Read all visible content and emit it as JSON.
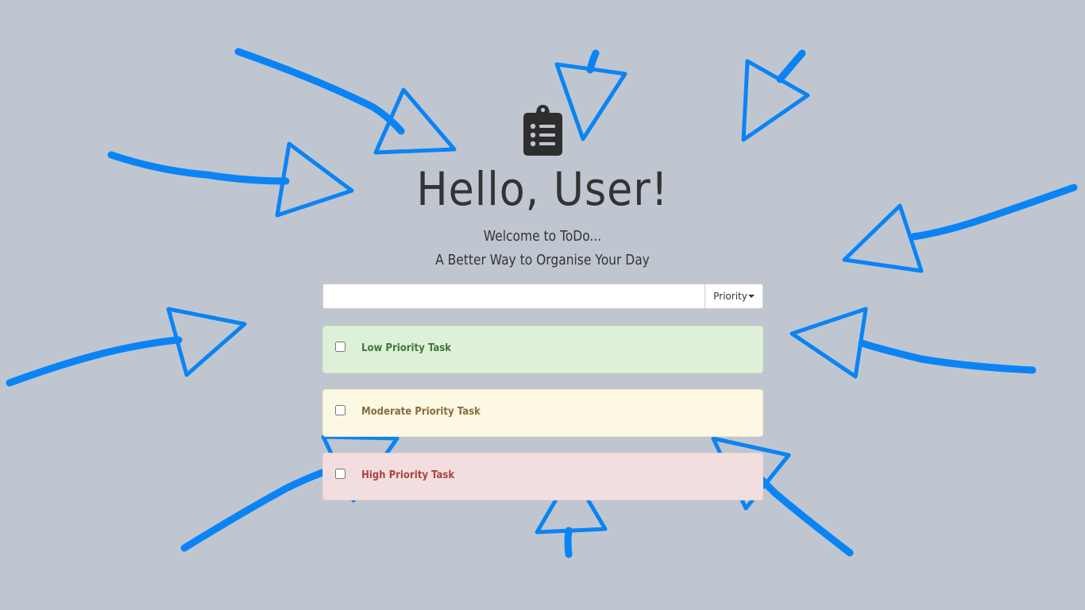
{
  "header": {
    "logo_icon": "clipboard-list-icon",
    "greeting": "Hello, User!",
    "subtitle_line1": "Welcome to ToDo...",
    "subtitle_line2": "A Better Way to Organise Your Day"
  },
  "new_task": {
    "value": "",
    "placeholder": "",
    "priority_label": "Priority",
    "priority_icon": "caret-down-icon"
  },
  "tasks": [
    {
      "label": "Low Priority Task",
      "priority": "low",
      "checked": false,
      "color": "#3c763d"
    },
    {
      "label": "Moderate Priority Task",
      "priority": "moderate",
      "checked": false,
      "color": "#8a6d3b"
    },
    {
      "label": "High Priority Task",
      "priority": "high",
      "checked": false,
      "color": "#a94442"
    }
  ],
  "colors": {
    "background": "#c0c6cf",
    "arrows": "#0a84f5",
    "low_bg": "#dff0d8",
    "moderate_bg": "#fcf8e3",
    "high_bg": "#f2dede"
  }
}
